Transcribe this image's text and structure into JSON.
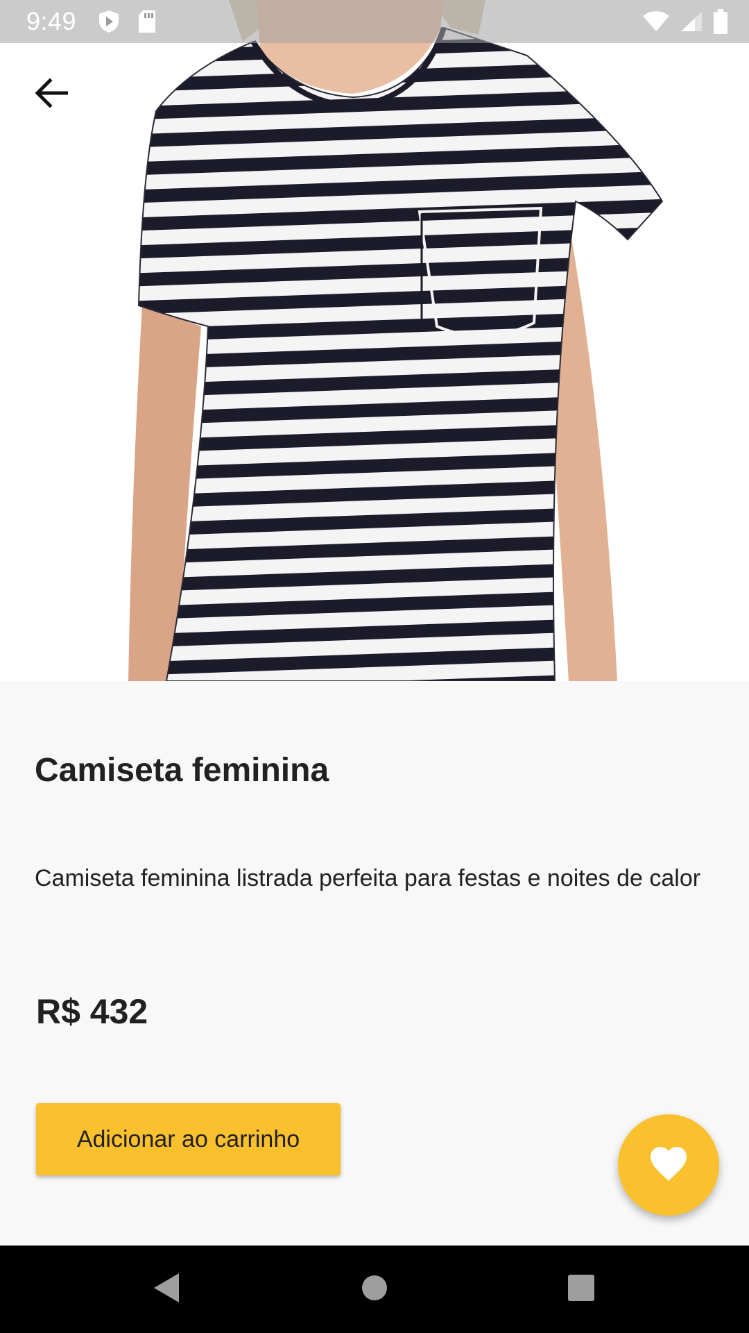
{
  "status_bar": {
    "time": "9:49",
    "icons": [
      "play-protect-icon",
      "sd-card-icon",
      "wifi-icon",
      "signal-icon",
      "battery-icon"
    ]
  },
  "toolbar": {
    "back_icon": "arrow-back-icon"
  },
  "product": {
    "image_icon": "striped-tshirt-photo",
    "title": "Camiseta feminina",
    "description": "Camiseta feminina listrada perfeita para festas e noites de calor",
    "price": "R$ 432"
  },
  "actions": {
    "add_to_cart_label": "Adicionar ao carrinho",
    "favorite_icon": "heart-icon"
  },
  "nav_bar": {
    "icons": [
      "back-triangle-icon",
      "home-circle-icon",
      "recents-square-icon"
    ]
  },
  "colors": {
    "accent": "#fbc02d",
    "background": "#f8f8f8",
    "text": "#212121",
    "stripe": "#1c1b2a"
  }
}
